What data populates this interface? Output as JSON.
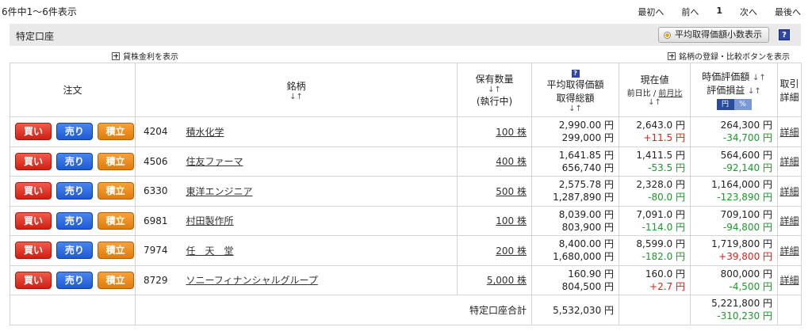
{
  "header": {
    "result_count": "6件中1～6件表示",
    "pager": {
      "first": "最初へ",
      "prev": "前へ",
      "page": "1",
      "next": "次へ",
      "last": "最後へ"
    }
  },
  "account": {
    "title": "特定口座",
    "avg_decimal_button": "平均取得価額小数表示",
    "help_icon_label": "?"
  },
  "links": {
    "lending": "貸株金利を表示",
    "register": "銘柄の登録・比較ボタンを表示"
  },
  "columns": {
    "order": "注文",
    "name": "銘柄",
    "qty_line1": "保有数量",
    "qty_line2": "(執行中)",
    "avg_line1": "平均取得価額",
    "avg_line2": "取得総額",
    "price_line1": "現在値",
    "price_prev_day": "前日比",
    "price_sep": "/",
    "price_prev_month": "前月比",
    "value_line1": "時価評価額",
    "value_line2": "評価損益",
    "unit_yen": "円",
    "unit_pct": "%",
    "trade_line1": "取引",
    "trade_line2": "詳細",
    "sort_mark": "↓↑",
    "help_mark": "?"
  },
  "buttons": {
    "buy": "買い",
    "sell": "売り",
    "tsumitate": "積立"
  },
  "rows": [
    {
      "code": "4204",
      "name": "積水化学",
      "qty": "100 株",
      "avg_price": "2,990.00 円",
      "total_cost": "299,000 円",
      "price": "2,643.0 円",
      "change": "+11.5 円",
      "change_sign": "pos",
      "market_value": "264,300 円",
      "pl": "-34,700 円",
      "pl_sign": "neg",
      "detail": "詳細"
    },
    {
      "code": "4506",
      "name": "住友ファーマ",
      "qty": "400 株",
      "avg_price": "1,641.85 円",
      "total_cost": "656,740 円",
      "price": "1,411.5 円",
      "change": "-53.5 円",
      "change_sign": "neg",
      "market_value": "564,600 円",
      "pl": "-92,140 円",
      "pl_sign": "neg",
      "detail": "詳細"
    },
    {
      "code": "6330",
      "name": "東洋エンジニア",
      "qty": "500 株",
      "avg_price": "2,575.78 円",
      "total_cost": "1,287,890 円",
      "price": "2,328.0 円",
      "change": "-80.0 円",
      "change_sign": "neg",
      "market_value": "1,164,000 円",
      "pl": "-123,890 円",
      "pl_sign": "neg",
      "detail": "詳細"
    },
    {
      "code": "6981",
      "name": "村田製作所",
      "qty": "100 株",
      "avg_price": "8,039.00 円",
      "total_cost": "803,900 円",
      "price": "7,091.0 円",
      "change": "-114.0 円",
      "change_sign": "neg",
      "market_value": "709,100 円",
      "pl": "-94,800 円",
      "pl_sign": "neg",
      "detail": "詳細"
    },
    {
      "code": "7974",
      "name": "任　天　堂",
      "qty": "200 株",
      "avg_price": "8,400.00 円",
      "total_cost": "1,680,000 円",
      "price": "8,599.0 円",
      "change": "-182.0 円",
      "change_sign": "neg",
      "market_value": "1,719,800 円",
      "pl": "+39,800 円",
      "pl_sign": "pos",
      "detail": "詳細"
    },
    {
      "code": "8729",
      "name": "ソニーフィナンシャルグループ",
      "qty": "5,000 株",
      "avg_price": "160.90 円",
      "total_cost": "804,500 円",
      "price": "160.0 円",
      "change": "+2.7 円",
      "change_sign": "pos",
      "market_value": "800,000 円",
      "pl": "-4,500 円",
      "pl_sign": "neg",
      "detail": "詳細"
    }
  ],
  "total": {
    "label": "特定口座合計",
    "total_cost": "5,532,030 円",
    "market_value": "5,221,800 円",
    "pl": "-310,230 円"
  }
}
